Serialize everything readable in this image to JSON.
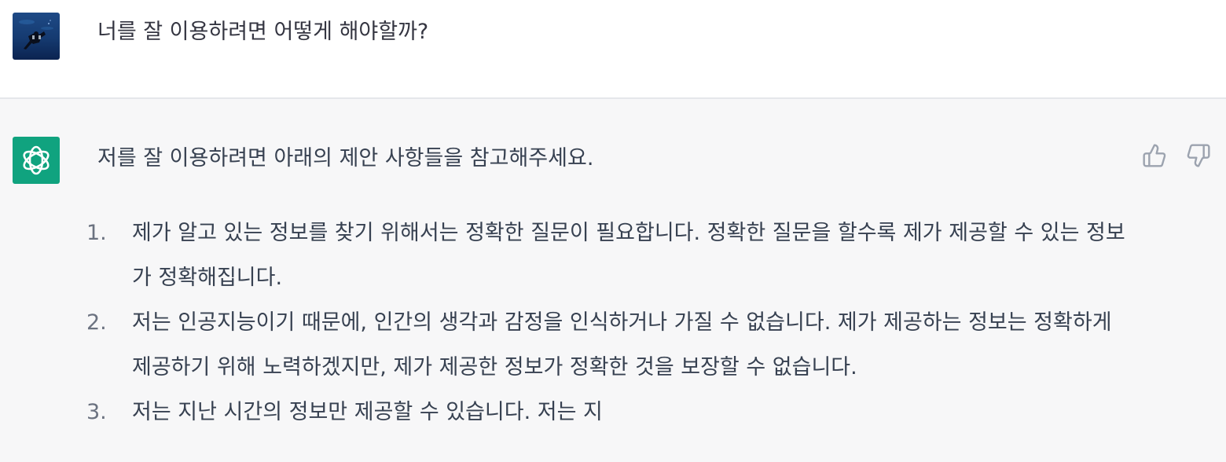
{
  "user_message": {
    "text": "너를 잘 이용하려면 어떻게 해야할까?",
    "avatar": "user-photo-avatar"
  },
  "assistant_message": {
    "avatar_color": "#10a37f",
    "avatar": "openai-logo-icon",
    "intro": "저를 잘 이용하려면 아래의 제안 사항들을 참고해주세요.",
    "items": [
      {
        "number": "1.",
        "text": "제가 알고 있는 정보를 찾기 위해서는 정확한 질문이 필요합니다. 정확한 질문을 할수록 제가 제공할 수 있는 정보가 정확해집니다."
      },
      {
        "number": "2.",
        "text": "저는 인공지능이기 때문에, 인간의 생각과 감정을 인식하거나 가질 수 없습니다. 제가 제공하는 정보는 정확하게 제공하기 위해 노력하겠지만, 제가 제공한 정보가 정확한 것을 보장할 수 없습니다."
      },
      {
        "number": "3.",
        "text": "저는 지난 시간의 정보만 제공할 수 있습니다. 저는 지"
      }
    ],
    "feedback": {
      "up_icon": "thumbs-up-icon",
      "down_icon": "thumbs-down-icon"
    }
  },
  "colors": {
    "user_bg": "#ffffff",
    "assistant_bg": "#f7f7f8",
    "text": "#374151",
    "list_number": "#6b7280",
    "icon": "#9ca3af",
    "divider": "#e5e7eb"
  }
}
